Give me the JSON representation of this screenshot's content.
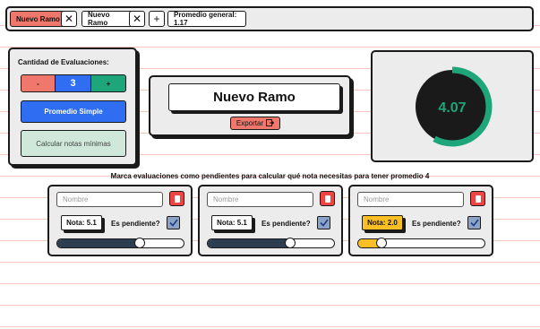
{
  "tabs": [
    {
      "label": "Nuevo Ramo",
      "active": true
    },
    {
      "label": "Nuevo Ramo",
      "active": false
    }
  ],
  "promedio_general": "Promedio general: 1.17",
  "colors": {
    "accent_red": "#f0776b",
    "blue": "#2f6df3",
    "green": "#1ea57a",
    "yellow": "#fbbf24",
    "navy": "#2c3e50"
  },
  "evaluaciones": {
    "title": "Cantidad de Evaluaciones:",
    "minus": "-",
    "count": "3",
    "plus": "+",
    "promedio_simple": "Promedio Simple",
    "calcular": "Calcular notas mínimas"
  },
  "ramo": {
    "name": "Nuevo Ramo",
    "export_label": "Exportar"
  },
  "gauge": {
    "value": "4.07",
    "fraction": 0.58
  },
  "instruction": "Marca evaluaciones como pendientes para calcular qué nota necesitas para tener promedio 4",
  "cards": [
    {
      "placeholder": "Nombre",
      "nota": "Nota: 5.1",
      "pendiente": "Es pendiente?",
      "checked": true,
      "slider": 0.65
    },
    {
      "placeholder": "Nombre",
      "nota": "Nota: 5.1",
      "pendiente": "Es pendiente?",
      "checked": true,
      "slider": 0.65
    },
    {
      "placeholder": "Nombre",
      "nota": "Nota: 2.0",
      "pendiente": "Es pendiente?",
      "checked": true,
      "slider": 0.19,
      "highlight": true
    }
  ]
}
